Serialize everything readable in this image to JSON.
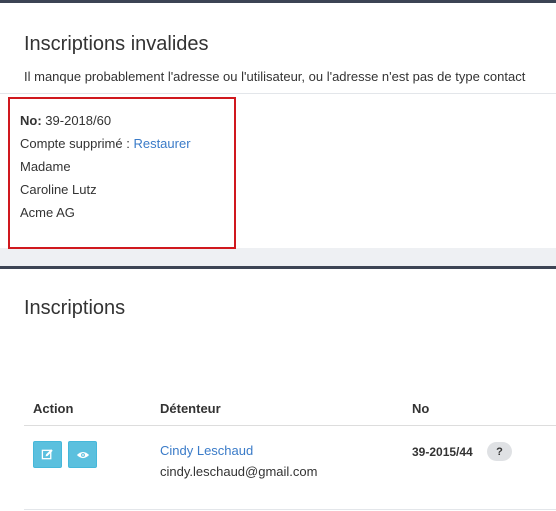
{
  "invalid_panel": {
    "title": "Inscriptions invalides",
    "description": "Il manque probablement l'adresse ou l'utilisateur, ou l'adresse n'est pas de type contact",
    "entry": {
      "no_label": "No:",
      "no_value": "39-2018/60",
      "deleted_label": "Compte supprimé :",
      "restore_link": "Restaurer",
      "salutation": "Madame",
      "name": "Caroline Lutz",
      "company": "Acme AG"
    }
  },
  "inscriptions_panel": {
    "title": "Inscriptions",
    "columns": {
      "action": "Action",
      "holder": "Détenteur",
      "no": "No"
    },
    "rows": [
      {
        "holder_name": "Cindy Leschaud",
        "holder_email": "cindy.leschaud@gmail.com",
        "no": "39-2015/44",
        "help_badge": "?",
        "actions": [
          "edit-icon",
          "eye-icon"
        ]
      }
    ]
  },
  "colors": {
    "accent_link": "#3a7bc8",
    "button_info": "#5bc0de",
    "highlight_border": "#d0181e",
    "panel_top_border": "#3c4454"
  }
}
